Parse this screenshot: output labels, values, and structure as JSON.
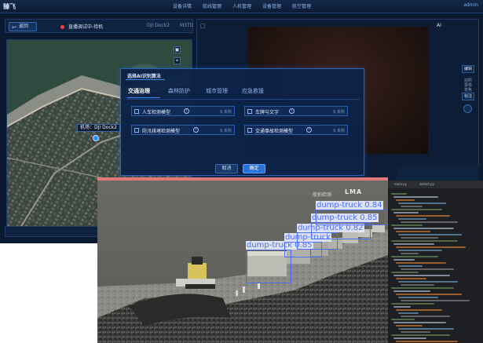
{
  "app": {
    "logo": "臻飞",
    "nav_tabs": [
      "设备详情",
      "航线管理",
      "人机管理",
      "设备管理",
      "航空管理"
    ],
    "user": "admin",
    "back_label": "返回",
    "record_text": "直播调试中-待机",
    "dock_label": "DJI Dock2",
    "mode_label": "M3TD",
    "drone_label": "机场：DJI Dock2",
    "ai_label": "AI",
    "side_buttons": [
      "编辑",
      "标注"
    ],
    "side_text": "拍照 录像 变焦",
    "right_tabs": [
      "一键起飞",
      "基础遥控",
      "返航"
    ]
  },
  "dialog": {
    "title": "选择AI识别算法",
    "tabs": [
      {
        "label": "交通治理",
        "active": true
      },
      {
        "label": "森林防护",
        "active": false
      },
      {
        "label": "城市管理",
        "active": false
      },
      {
        "label": "应急救援",
        "active": false
      }
    ],
    "models": [
      {
        "label": "人车检测模型",
        "status": "0 未购"
      },
      {
        "label": "车牌与文字",
        "status": "0 未购"
      },
      {
        "label": "防汛排堵检测模型",
        "status": "0 未购"
      },
      {
        "label": "交通事故检测模型",
        "status": "0 未购"
      }
    ],
    "cancel_label": "取消",
    "ok_label": "确定"
  },
  "video": {
    "watermark": "航拍检测",
    "watermark_logo": "LMA",
    "detections": [
      {
        "label": "dump-truck 0.84"
      },
      {
        "label": "dump-truck 0.85"
      },
      {
        "label": "dump-truck 0.82"
      },
      {
        "label": "dump-truck"
      },
      {
        "label": "dump-truck 0.85"
      }
    ]
  },
  "ide": {
    "tabs": [
      "main.py",
      "detect.py"
    ]
  },
  "colors": {
    "app_bg": "#0b1a30",
    "accent": "#2f8cff",
    "detection_box": "#4c6dff",
    "record_dot": "#ff3b3b"
  }
}
